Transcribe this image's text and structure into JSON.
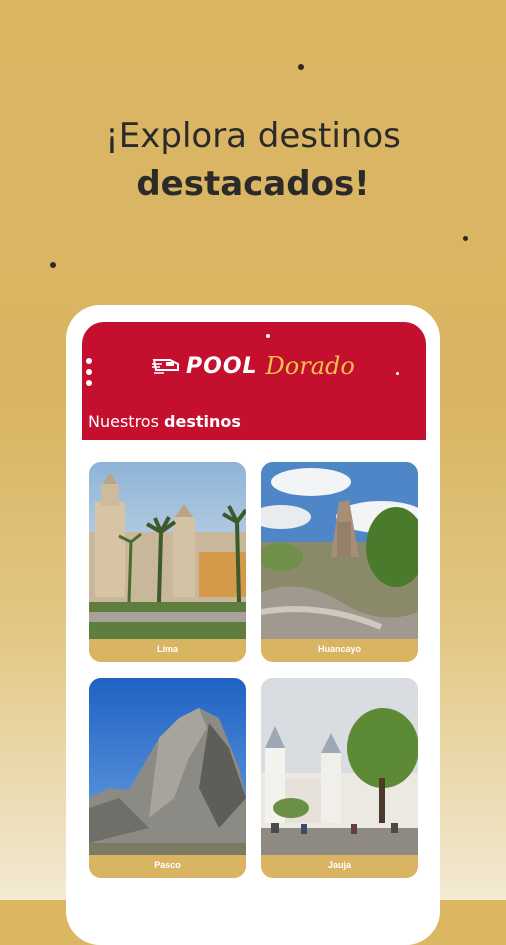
{
  "headline": {
    "line1": "¡Explora destinos",
    "line2": "destacados!"
  },
  "app": {
    "logo": {
      "pool": "POOL",
      "dorado": "Dorado"
    },
    "section": {
      "prefix": "Nuestros",
      "bold": "destinos"
    },
    "colors": {
      "header": "#c4102e",
      "accent": "#d9b563",
      "background": "#dbb764"
    }
  },
  "destinations": [
    {
      "name": "Lima"
    },
    {
      "name": "Huancayo"
    },
    {
      "name": "Pasco"
    },
    {
      "name": "Jauja"
    }
  ]
}
